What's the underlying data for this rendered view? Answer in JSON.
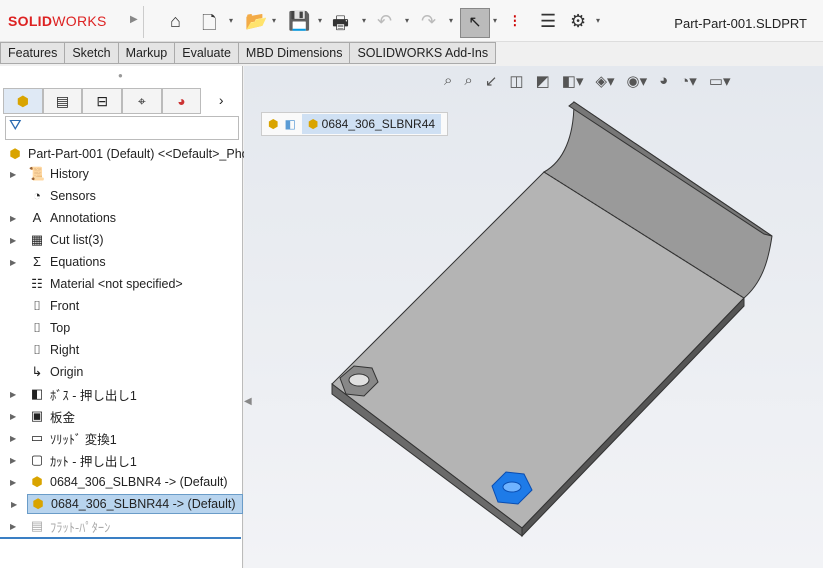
{
  "app": {
    "brand_bold": "SOLID",
    "brand_light": "WORKS",
    "document_title": "Part-Part-001.SLDPRT"
  },
  "toolbar": {
    "icons": [
      "home-icon",
      "new-document-icon",
      "open-icon",
      "save-icon",
      "print-icon",
      "undo-icon",
      "redo-icon",
      "select-icon",
      "rebuild-icon",
      "file-properties-icon",
      "options-icon"
    ]
  },
  "tabs": [
    "Features",
    "Sketch",
    "Markup",
    "Evaluate",
    "MBD Dimensions",
    "SOLIDWORKS Add-Ins"
  ],
  "tree": {
    "root": "Part-Part-001 (Default) <<Default>_Phot",
    "items": [
      {
        "label": "History",
        "icon": "📜",
        "expand": true
      },
      {
        "label": "Sensors",
        "icon": "◔",
        "expand": false
      },
      {
        "label": "Annotations",
        "icon": "A",
        "expand": true
      },
      {
        "label": "Cut list(3)",
        "icon": "▦",
        "expand": true
      },
      {
        "label": "Equations",
        "icon": "Σ",
        "expand": true
      },
      {
        "label": "Material <not specified>",
        "icon": "☷",
        "expand": false
      },
      {
        "label": "Front",
        "icon": "⌷",
        "expand": false
      },
      {
        "label": "Top",
        "icon": "⌷",
        "expand": false
      },
      {
        "label": "Right",
        "icon": "⌷",
        "expand": false
      },
      {
        "label": "Origin",
        "icon": "↳",
        "expand": false
      },
      {
        "label": "ﾎﾞｽ - 押し出し1",
        "icon": "◧",
        "expand": true
      },
      {
        "label": "板金",
        "icon": "▣",
        "expand": true
      },
      {
        "label": "ｿﾘｯﾄﾞ 変換1",
        "icon": "▭",
        "expand": true
      },
      {
        "label": "ｶｯﾄ - 押し出し1",
        "icon": "▢",
        "expand": true
      },
      {
        "label": "0684_306_SLBNR4 -> (Default)",
        "icon": "⬢",
        "expand": true
      },
      {
        "label": "0684_306_SLBNR44 -> (Default)",
        "icon": "⬢",
        "expand": true,
        "selected": true
      },
      {
        "label": "ﾌﾗｯﾄ-ﾊﾟﾀｰﾝ",
        "icon": "▤",
        "expand": true,
        "dim": true
      }
    ]
  },
  "breadcrumb": {
    "current": "0684_306_SLBNR44"
  },
  "colors": {
    "brand": "#d22222",
    "selection": "#1e7be8"
  }
}
